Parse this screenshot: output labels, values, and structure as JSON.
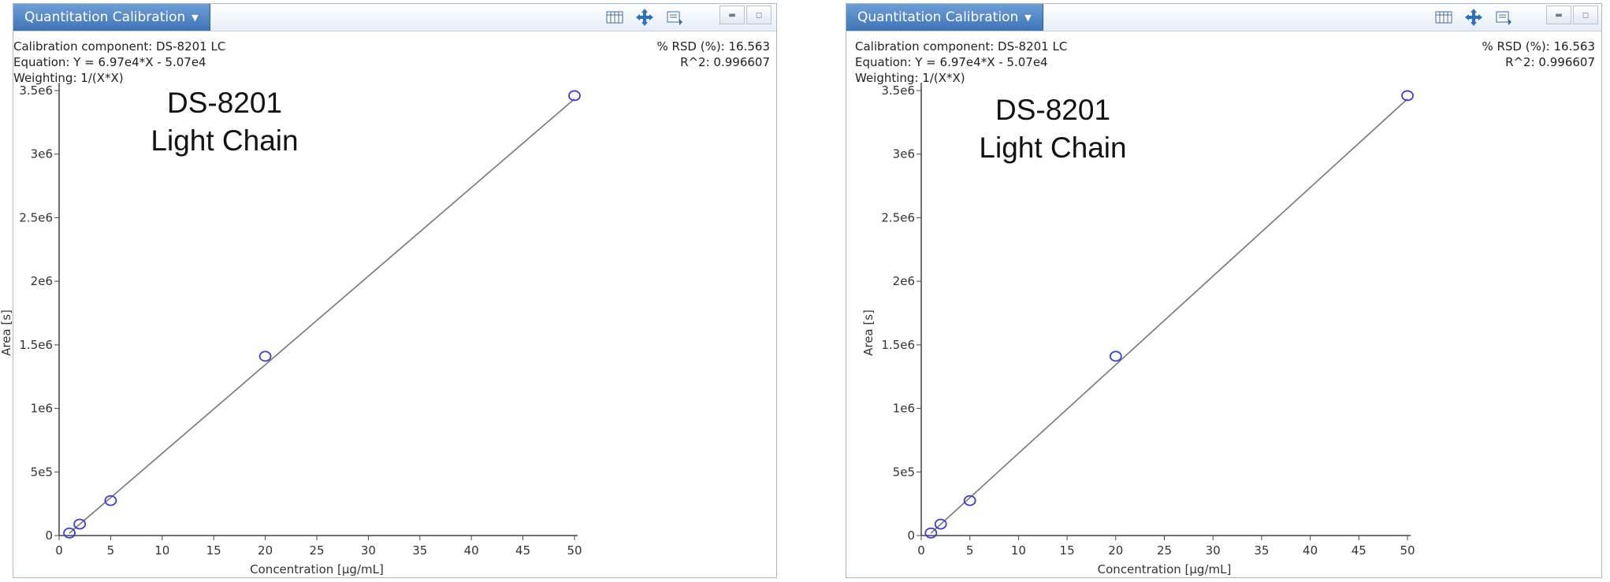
{
  "panels": [
    {
      "title": "Quantitation Calibration",
      "component": "Calibration component: DS-8201 LC",
      "equation": "Equation: Y = 6.97e4*X - 5.07e4",
      "weighting": "Weighting: 1/(X*X)",
      "rsd": "% RSD (%): 16.563",
      "r2": "R^2: 0.996607",
      "overlay": [
        "DS-8201",
        "Light Chain"
      ]
    },
    {
      "title": "Quantitation Calibration",
      "component": "Calibration component: DS-8201 LC",
      "equation": "Equation: Y = 6.97e4*X - 5.07e4",
      "weighting": "Weighting: 1/(X*X)",
      "rsd": "% RSD (%): 16.563",
      "r2": "R^2: 0.996607",
      "overlay": [
        "DS-8201",
        "Light Chain"
      ]
    }
  ],
  "icons": [
    "table-icon",
    "move-icon",
    "export-icon",
    "minimize-icon",
    "restore-icon"
  ],
  "colors": {
    "titlebar": "#4a7fc1",
    "point": "#3a3ad6",
    "line": "#777777"
  },
  "chart_data": [
    {
      "type": "scatter",
      "xlabel": "Concentration [µg/mL]",
      "ylabel": "Area [s]",
      "xlim": [
        0,
        50
      ],
      "ylim": [
        0,
        3500000
      ],
      "xticks": [
        0,
        5,
        10,
        15,
        20,
        25,
        30,
        35,
        40,
        45,
        50
      ],
      "xtick_labels": [
        "0",
        "5",
        "10",
        "15",
        "20",
        "25",
        "30",
        "35",
        "40",
        "45",
        "50"
      ],
      "yticks": [
        0,
        500000,
        1000000,
        1500000,
        2000000,
        2500000,
        3000000,
        3500000
      ],
      "ytick_labels": [
        "0",
        "5e5",
        "1e6",
        "1.5e6",
        "2e6",
        "2.5e6",
        "3e6",
        "3.5e6"
      ],
      "points": {
        "x": [
          1,
          2,
          5,
          20,
          50
        ],
        "y": [
          20000,
          90000,
          275000,
          1410000,
          3460000
        ]
      },
      "fit": {
        "slope": 69700,
        "intercept": -50700
      },
      "grid": false
    },
    {
      "type": "scatter",
      "xlabel": "Concentration [µg/mL]",
      "ylabel": "Area [s]",
      "xlim": [
        0,
        50
      ],
      "ylim": [
        0,
        3500000
      ],
      "xticks": [
        0,
        5,
        10,
        15,
        20,
        25,
        30,
        35,
        40,
        45,
        50
      ],
      "xtick_labels": [
        "0",
        "5",
        "10",
        "15",
        "20",
        "25",
        "30",
        "35",
        "40",
        "45",
        "50"
      ],
      "yticks": [
        0,
        500000,
        1000000,
        1500000,
        2000000,
        2500000,
        3000000,
        3500000
      ],
      "ytick_labels": [
        "0",
        "5e5",
        "1e6",
        "1.5e6",
        "2e6",
        "2.5e6",
        "3e6",
        "3.5e6"
      ],
      "points": {
        "x": [
          1,
          2,
          5,
          20,
          50
        ],
        "y": [
          20000,
          90000,
          275000,
          1410000,
          3460000
        ]
      },
      "fit": {
        "slope": 69700,
        "intercept": -50700
      },
      "grid": false
    }
  ]
}
